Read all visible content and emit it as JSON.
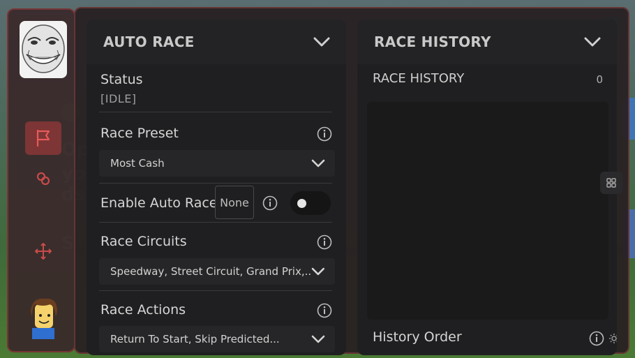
{
  "background": {
    "fragments": [
      "Op",
      "yo",
      "ds",
      "S"
    ]
  },
  "sidebar": {
    "items": [
      {
        "name": "avatar-top",
        "icon": "troll-face-avatar"
      },
      {
        "name": "race",
        "icon": "flag-icon",
        "active": true
      },
      {
        "name": "link",
        "icon": "link-icon"
      },
      {
        "name": "move",
        "icon": "move-arrows-icon"
      },
      {
        "name": "avatar-bottom",
        "icon": "player-avatar"
      }
    ]
  },
  "window": {
    "close_label": "×",
    "accent": "#b43c3c"
  },
  "auto_race": {
    "title": "AUTO RACE",
    "status": {
      "label": "Status",
      "value": "[IDLE]"
    },
    "race_preset": {
      "label": "Race Preset",
      "selected": "Most Cash"
    },
    "enable_auto_race": {
      "label": "Enable Auto Race",
      "keybind": "None",
      "enabled": false
    },
    "race_circuits": {
      "label": "Race Circuits",
      "selected": "Speedway, Street Circuit, Grand Prix,..."
    },
    "race_actions": {
      "label": "Race Actions",
      "selected": "Return To Start, Skip Predicted..."
    }
  },
  "race_history": {
    "title": "RACE HISTORY",
    "list_label": "RACE HISTORY",
    "count": "0",
    "history_order_label": "History Order"
  }
}
